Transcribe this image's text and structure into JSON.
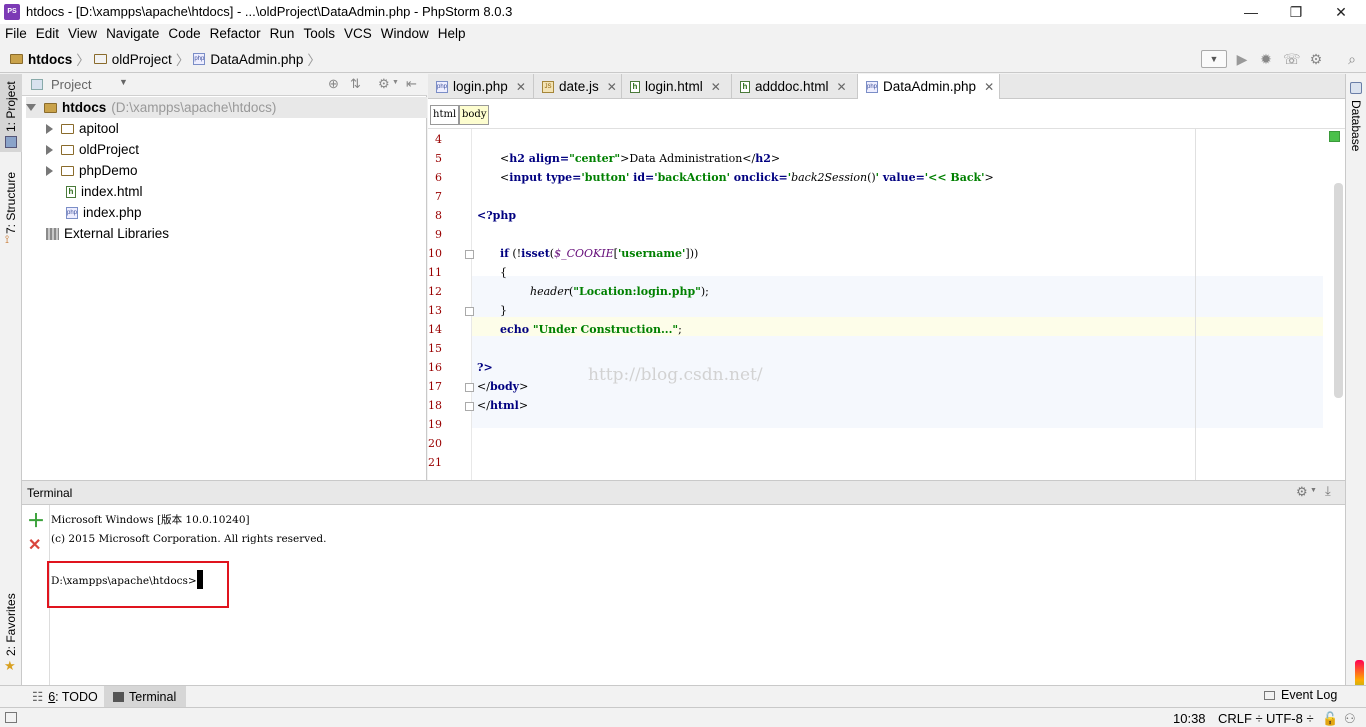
{
  "window": {
    "title": "htdocs - [D:\\xampps\\apache\\htdocs] - ...\\oldProject\\DataAdmin.php - PhpStorm 8.0.3",
    "logo": "PS",
    "minimize": "—",
    "restore": "❐",
    "close": "✕"
  },
  "menu": [
    "File",
    "Edit",
    "View",
    "Navigate",
    "Code",
    "Refactor",
    "Run",
    "Tools",
    "VCS",
    "Window",
    "Help"
  ],
  "breadcrumb": [
    "htdocs",
    "oldProject",
    "DataAdmin.php"
  ],
  "project": {
    "header": "Project",
    "root": "htdocs",
    "root_path": "(D:\\xampps\\apache\\htdocs)",
    "items": [
      "apitool",
      "oldProject",
      "phpDemo",
      "index.html",
      "index.php"
    ],
    "external": "External Libraries"
  },
  "side_tabs": {
    "project": "1: Project",
    "structure": "7: Structure",
    "favorites": "2: Favorites",
    "database": "Database"
  },
  "tabs": [
    "login.php",
    "date.js",
    "login.html",
    "adddoc.html",
    "DataAdmin.php"
  ],
  "editor_breadcrumb": [
    "html",
    "body"
  ],
  "line_numbers": [
    "4",
    "5",
    "6",
    "7",
    "8",
    "9",
    "10",
    "11",
    "12",
    "13",
    "14",
    "15",
    "16",
    "17",
    "18",
    "19",
    "20",
    "21"
  ],
  "code": {
    "l5_a": "<",
    "l5_tag": "h2",
    "l5_attr": " align=",
    "l5_val": "\"center\"",
    "l5_text": ">Data Administration</",
    "l5_tag2": "h2",
    "l5_end": ">",
    "l6_a": "<",
    "l6_tag": "input",
    "l6_attr1": " type=",
    "l6_val1": "'button'",
    "l6_attr2": " id=",
    "l6_val2": "'backAction'",
    "l6_attr3": " onclick=",
    "l6_q1": "'",
    "l6_fn": "back2Session",
    "l6_fnp": "()",
    "l6_q2": "'",
    "l6_attr4": " value=",
    "l6_val4": "'<< Back'",
    "l6_end": ">",
    "l8": "<?php",
    "l10_kw": "if",
    "l10_a": " (!",
    "l10_fn": "isset",
    "l10_b": "(",
    "l10_var": "$_COOKIE",
    "l10_c": "[",
    "l10_str": "'username'",
    "l10_d": "]))",
    "l11": "{",
    "l12_fn": "header",
    "l12_a": "(",
    "l12_str": "\"Location:login.php\"",
    "l12_b": ");",
    "l13": "}",
    "l14_kw": "echo",
    "l14_str": " \"Under Construction...\"",
    "l14_end": ";",
    "l16": "?>",
    "l17_a": "</",
    "l17_tag": "body",
    "l17_b": ">",
    "l18_a": "</",
    "l18_tag": "html",
    "l18_b": ">",
    "watermark": "http://blog.csdn.net/"
  },
  "terminal": {
    "title": "Terminal",
    "line1": "Microsoft Windows [版本 10.0.10240]",
    "line2": "(c) 2015 Microsoft Corporation. All rights reserved.",
    "prompt": "D:\\xampps\\apache\\htdocs>"
  },
  "bottom_tabs": {
    "todo_num": "6",
    "todo": ": TODO",
    "terminal": "Terminal",
    "event_log": "Event Log"
  },
  "status": {
    "position": "10:38",
    "line_sep": "CRLF ÷",
    "encoding": "UTF-8 ÷"
  },
  "colors": {
    "highlight_box": "#e0141e",
    "accent_green": "#3aa13a",
    "close_red": "#d9453d"
  }
}
